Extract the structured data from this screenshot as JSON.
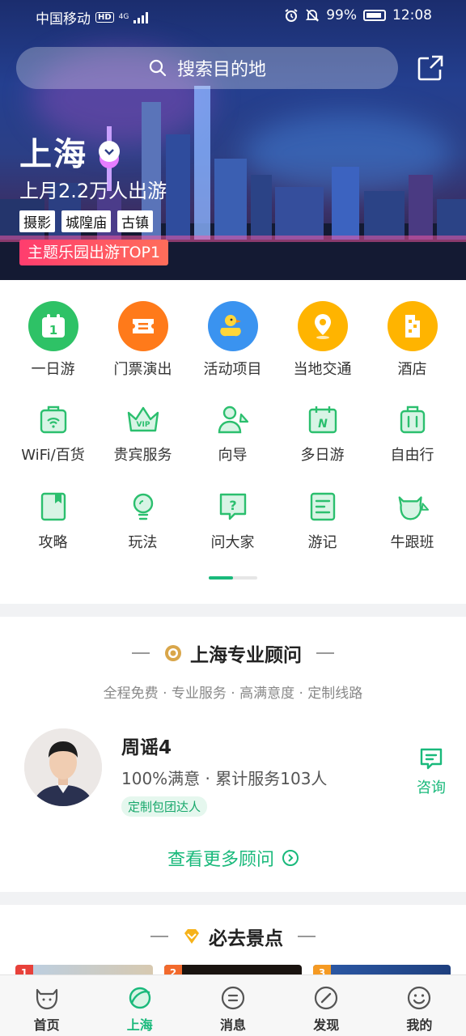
{
  "status_bar": {
    "carrier": "中国移动",
    "hd": "HD",
    "network": "4G",
    "battery": "99%",
    "time": "12:08"
  },
  "hero": {
    "search_placeholder": "搜索目的地",
    "city": "上海",
    "trip_count": "上月2.2万人出游",
    "tags": [
      "摄影",
      "城隍庙",
      "古镇"
    ],
    "rank_badge": "主题乐园出游TOP1"
  },
  "categories_primary": [
    {
      "label": "一日游",
      "icon": "calendar-icon",
      "color": "#2ec266"
    },
    {
      "label": "门票演出",
      "icon": "ticket-icon",
      "color": "#ff7a1a"
    },
    {
      "label": "活动项目",
      "icon": "duck-icon",
      "color": "#3a93f0"
    },
    {
      "label": "当地交通",
      "icon": "location-pin-icon",
      "color": "#ffb400"
    },
    {
      "label": "酒店",
      "icon": "hotel-icon",
      "color": "#ffb400"
    }
  ],
  "categories_secondary": [
    {
      "label": "WiFi/百货",
      "icon": "wifi-suitcase-icon"
    },
    {
      "label": "贵宾服务",
      "icon": "vip-crown-icon"
    },
    {
      "label": "向导",
      "icon": "guide-person-icon"
    },
    {
      "label": "多日游",
      "icon": "multi-day-calendar-icon"
    },
    {
      "label": "自由行",
      "icon": "luggage-icon"
    },
    {
      "label": "攻略",
      "icon": "guidebook-icon"
    },
    {
      "label": "玩法",
      "icon": "lightbulb-icon"
    },
    {
      "label": "问大家",
      "icon": "question-bubble-icon"
    },
    {
      "label": "游记",
      "icon": "travel-notes-icon"
    },
    {
      "label": "牛跟班",
      "icon": "cow-mascot-icon"
    }
  ],
  "consultant_section": {
    "title": "上海专业顾问",
    "subtitle": "全程免费 · 专业服务 · 高满意度 · 定制线路",
    "name": "周谣4",
    "stats": "100%满意 · 累计服务103人",
    "badge": "定制包团达人",
    "consult_label": "咨询",
    "more_label": "查看更多顾问"
  },
  "must_visit": {
    "title": "必去景点",
    "ranks": [
      "1",
      "2",
      "3"
    ]
  },
  "tabs": [
    {
      "label": "首页",
      "icon": "cow-home-icon",
      "active": false
    },
    {
      "label": "上海",
      "icon": "planet-icon",
      "active": true
    },
    {
      "label": "消息",
      "icon": "message-icon",
      "active": false
    },
    {
      "label": "发现",
      "icon": "compass-icon",
      "active": false
    },
    {
      "label": "我的",
      "icon": "smiley-profile-icon",
      "active": false
    }
  ],
  "colors": {
    "accent": "#19b97b",
    "rank_badge": "#ff3d6e"
  }
}
